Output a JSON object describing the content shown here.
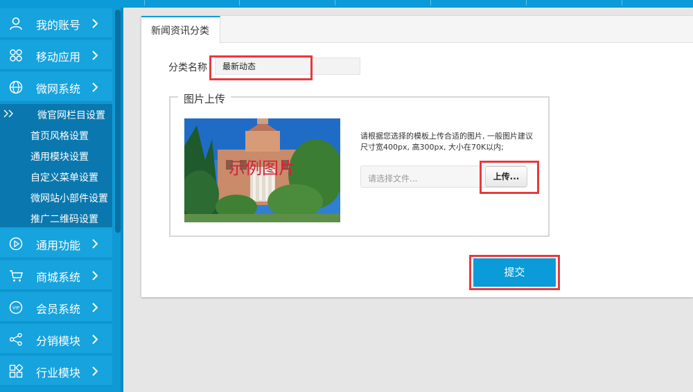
{
  "sidebar": {
    "items": [
      {
        "label": "我的账号",
        "icon": "user-icon"
      },
      {
        "label": "移动应用",
        "icon": "apps-icon"
      },
      {
        "label": "微网系统",
        "icon": "globe-icon"
      },
      {
        "label": "通用功能",
        "icon": "play-icon"
      },
      {
        "label": "商城系统",
        "icon": "cart-icon"
      },
      {
        "label": "会员系统",
        "icon": "vip-icon"
      },
      {
        "label": "分销模块",
        "icon": "share-icon"
      },
      {
        "label": "行业模块",
        "icon": "grid-icon"
      }
    ],
    "submenu": [
      {
        "label": "微官网栏目设置",
        "active": true
      },
      {
        "label": "首页风格设置"
      },
      {
        "label": "通用模块设置"
      },
      {
        "label": "自定义菜单设置"
      },
      {
        "label": "微网站小部件设置"
      },
      {
        "label": "推广二维码设置"
      }
    ]
  },
  "tab": {
    "label": "新闻资讯分类"
  },
  "form": {
    "name_label": "分类名称",
    "name_value": "最新动态",
    "upload_legend": "图片上传",
    "image_watermark": "示例图片",
    "hint_line1": "请根据您选择的模板上传合适的图片, 一般图片建议",
    "hint_line2": "尺寸宽400px, 高300px, 大小在70K以内;",
    "file_placeholder": "请选择文件...",
    "upload_label": "上传...",
    "submit_label": "提交"
  },
  "colors": {
    "accent": "#0a9bd8",
    "highlight": "#e8393d",
    "sidebar": "#16a3de",
    "submenu": "#0a78ae"
  }
}
